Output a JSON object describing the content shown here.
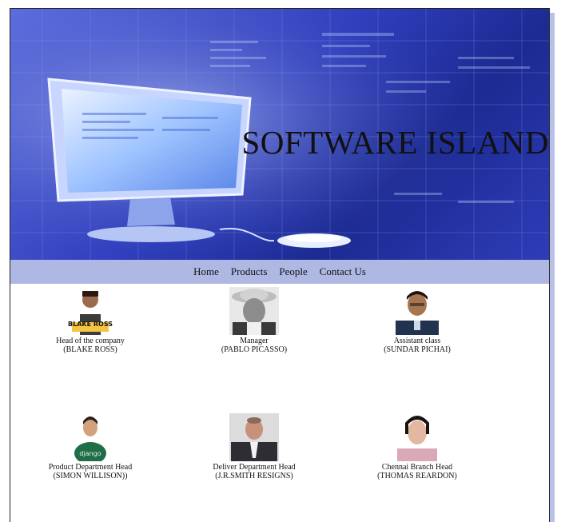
{
  "banner": {
    "title": "SOFTWARE ISLAND"
  },
  "nav": {
    "items": [
      "Home",
      "Products",
      "People",
      "Contact Us"
    ]
  },
  "people": [
    {
      "role": "Head of the company",
      "name": "(BLAKE ROSS)",
      "photo_text": "BLAKE ROSS"
    },
    {
      "role": "Manager",
      "name": "(PABLO PICASSO)"
    },
    {
      "role": "Assistant class",
      "name": "(SUNDAR PICHAI)"
    },
    {
      "role": "Product Department Head",
      "name": "(SIMON WILLISON))",
      "photo_text": "django"
    },
    {
      "role": "Deliver Department Head",
      "name": "(J.R.SMITH RESIGNS)"
    },
    {
      "role": "Chennai Branch Head",
      "name": "(THOMAS REARDON)"
    }
  ]
}
